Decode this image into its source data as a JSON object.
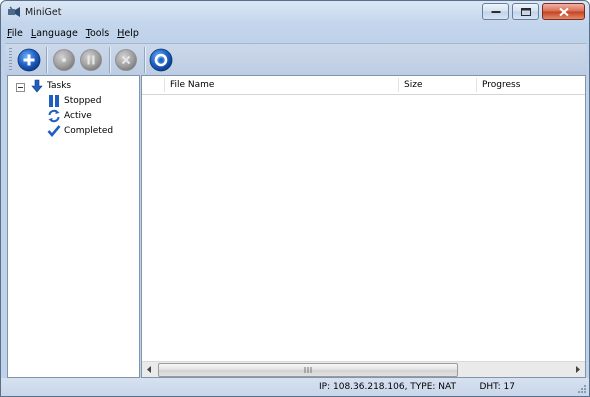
{
  "window": {
    "title": "MiniGet"
  },
  "menu": [
    {
      "label": "File",
      "mnemonic": "F"
    },
    {
      "label": "Language",
      "mnemonic": "L"
    },
    {
      "label": "Tools",
      "mnemonic": "T"
    },
    {
      "label": "Help",
      "mnemonic": "H"
    }
  ],
  "toolbar": {
    "buttons": [
      "add-icon",
      "start-icon",
      "pause-icon",
      "delete-icon",
      "settings-icon"
    ]
  },
  "tree": {
    "root": "Tasks",
    "children": [
      "Stopped",
      "Active",
      "Completed"
    ]
  },
  "list": {
    "columns": [
      "File Name",
      "Size",
      "Progress"
    ]
  },
  "status": {
    "connection": "IP: 108.36.218.106, TYPE: NAT",
    "dht": "DHT: 17"
  },
  "colors": {
    "accent": "#1f5fbf",
    "disabled": "#8a8a8a"
  }
}
